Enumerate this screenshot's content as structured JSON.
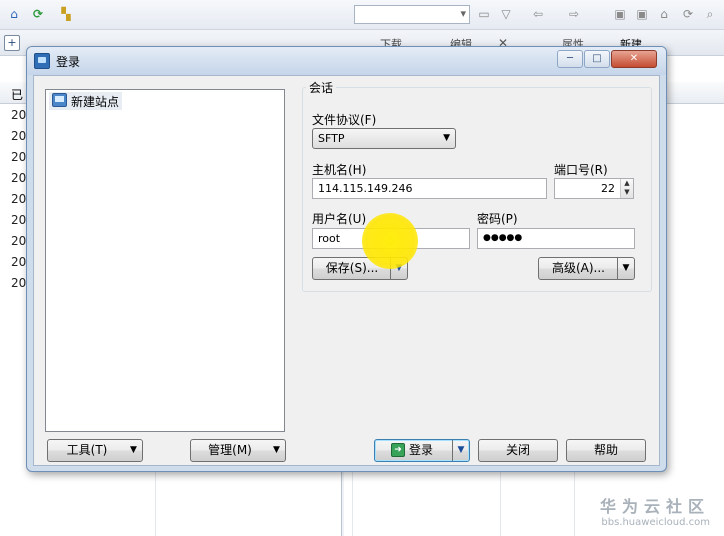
{
  "background": {
    "toolbar2": {
      "download_label": "下载",
      "edit_label": "编辑",
      "properties_label": "属性",
      "new_label": "新建"
    },
    "left_pane": {
      "header_label": "已",
      "rows": [
        "20",
        "20",
        "20",
        "20",
        "20",
        "20",
        "20",
        "20",
        "20"
      ]
    }
  },
  "dialog": {
    "title": "登录",
    "window_buttons": {
      "minimize": "─",
      "maximize": "□",
      "close": "✕"
    },
    "site_tree": {
      "items": [
        {
          "label": "新建站点"
        }
      ]
    },
    "session": {
      "group_label": "会话",
      "protocol_label": "文件协议(F)",
      "protocol_value": "SFTP",
      "host_label": "主机名(H)",
      "host_value": "114.115.149.246",
      "port_label": "端口号(R)",
      "port_value": "22",
      "user_label": "用户名(U)",
      "user_value": "root",
      "password_label": "密码(P)",
      "password_value": "●●●●●",
      "save_button": "保存(S)...",
      "advanced_button": "高级(A)..."
    },
    "footer": {
      "tools_button": "工具(T)",
      "manage_button": "管理(M)",
      "login_button": "登录",
      "close_button": "关闭",
      "help_button": "帮助"
    }
  },
  "watermark": {
    "line1": "华为云社区",
    "line2": "bbs.huaweicloud.com"
  },
  "colors": {
    "dialog_frame": "#cfdcec",
    "title_gradient_end": "#c5d5ea",
    "cursor_highlight": "#ffe600",
    "close_button": "#c44c32"
  },
  "icons": [
    "home-icon",
    "refresh-icon",
    "sync-icon",
    "dropdown-icon",
    "folder-icon",
    "back-icon",
    "forward-icon",
    "login-icon",
    "site-icon"
  ]
}
